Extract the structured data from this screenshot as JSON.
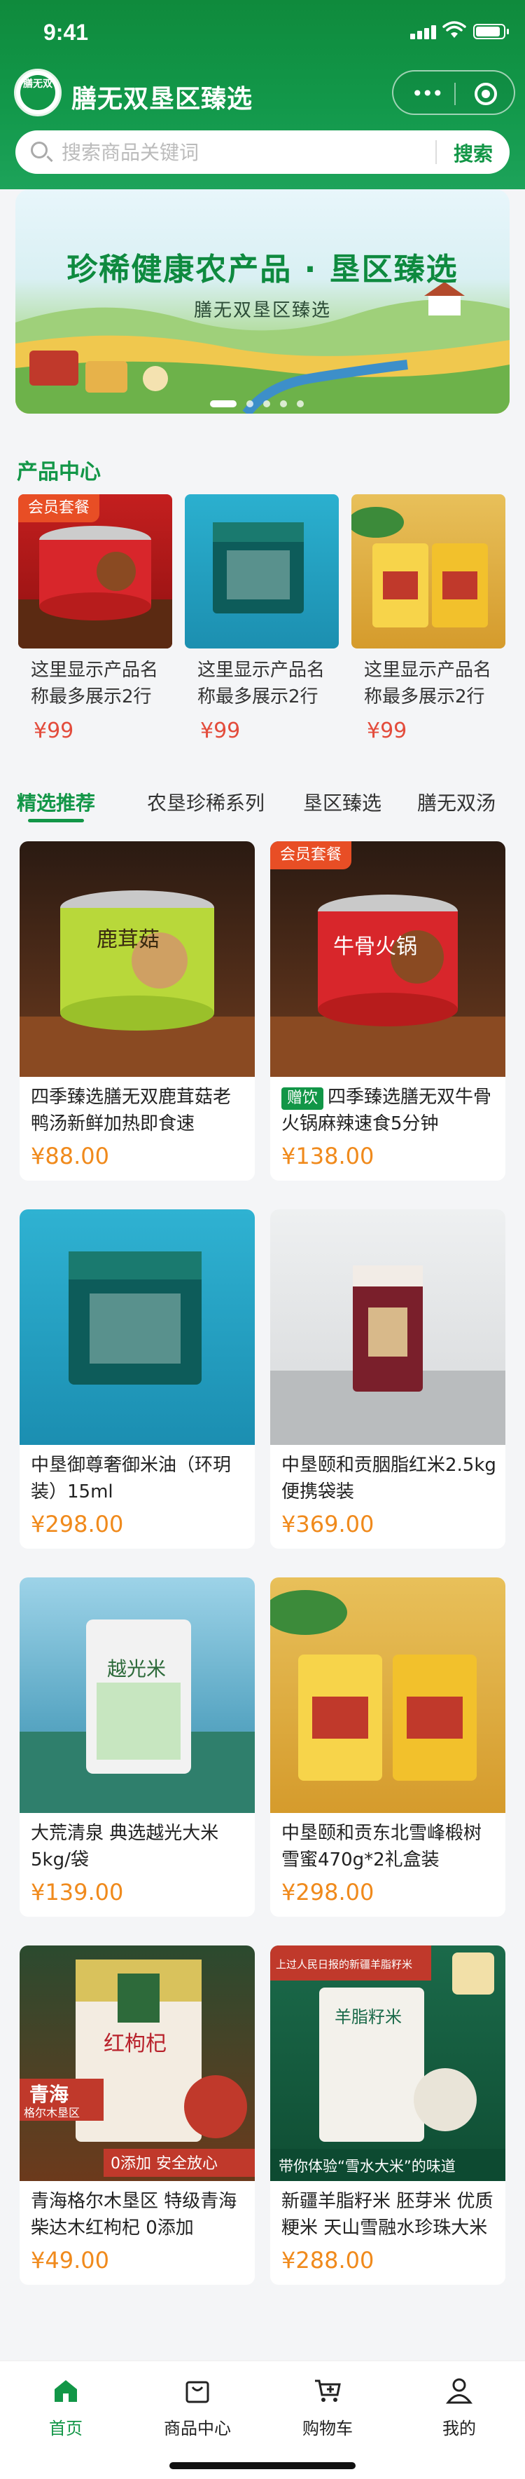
{
  "status_bar": {
    "time": "9:41"
  },
  "app": {
    "title": "膳无双垦区臻选",
    "logo_text": "膳无双",
    "capsule_more": "•••"
  },
  "search": {
    "placeholder": "搜索商品关键词",
    "button": "搜索"
  },
  "banner": {
    "title": "珍稀健康农产品 · 垦区臻选",
    "subtitle": "膳无双垦区臻选",
    "slides": 5,
    "active_slide": 0
  },
  "product_center": {
    "title": "产品中心",
    "items": [
      {
        "name": "这里显示产品名称最多展示2行",
        "price": "¥99",
        "badge": "会员套餐"
      },
      {
        "name": "这里显示产品名称最多展示2行",
        "price": "¥99",
        "badge": ""
      },
      {
        "name": "这里显示产品名称最多展示2行",
        "price": "¥99",
        "badge": ""
      }
    ]
  },
  "tabs": [
    {
      "label": "精选推荐",
      "active": true
    },
    {
      "label": "农垦珍稀系列",
      "active": false
    },
    {
      "label": "垦区臻选",
      "active": false
    },
    {
      "label": "膳无双汤",
      "active": false
    }
  ],
  "products": [
    {
      "title": "四季臻选膳无双鹿茸菇老鸭汤新鲜加热即食速",
      "price": "¥88.00",
      "badge": "",
      "tag": ""
    },
    {
      "title": "四季臻选膳无双牛骨火锅麻辣速食5分钟",
      "price": "¥138.00",
      "badge": "会员套餐",
      "tag": "赠饮"
    },
    {
      "title": "中垦御尊奢御米油（环玥装）15ml",
      "price": "¥298.00",
      "badge": "",
      "tag": ""
    },
    {
      "title": "中垦颐和贡胭脂红米2.5kg便携袋装",
      "price": "¥369.00",
      "badge": "",
      "tag": ""
    },
    {
      "title": "大荒清泉 典选越光大米5kg/袋",
      "price": "¥139.00",
      "badge": "",
      "tag": ""
    },
    {
      "title": "中垦颐和贡东北雪峰椴树雪蜜470g*2礼盒装",
      "price": "¥298.00",
      "badge": "",
      "tag": ""
    },
    {
      "title": "青海格尔木垦区 特级青海柴达木红枸杞 0添加",
      "price": "¥49.00",
      "badge": "",
      "tag": ""
    },
    {
      "title": "新疆羊脂籽米 胚芽米 优质粳米 天山雪融水珍珠大米",
      "price": "¥288.00",
      "badge": "",
      "tag": ""
    }
  ],
  "image_text": {
    "can_lu": "鹿茸菇",
    "can_niu": "牛骨火锅",
    "rice_bag": "越光米",
    "goji_title": "红枸杞",
    "qinghai": "青海",
    "qinghai_sub": "格尔木垦区",
    "goji_strip": "0添加 安全放心",
    "xj_top": "上过人民日报的新疆羊脂籽米",
    "xj_bag": "羊脂籽米",
    "xj_strip": "带你体验“雪水大米”的味道"
  },
  "bottom_nav": [
    {
      "label": "首页",
      "icon": "home-icon",
      "active": true
    },
    {
      "label": "商品中心",
      "icon": "bag-icon",
      "active": false
    },
    {
      "label": "购物车",
      "icon": "cart-icon",
      "active": false
    },
    {
      "label": "我的",
      "icon": "user-icon",
      "active": false
    }
  ],
  "colors": {
    "brand": "#129647",
    "price_orange": "#f08a1c",
    "price_red": "#e34c3c",
    "badge": "#e84e25"
  }
}
